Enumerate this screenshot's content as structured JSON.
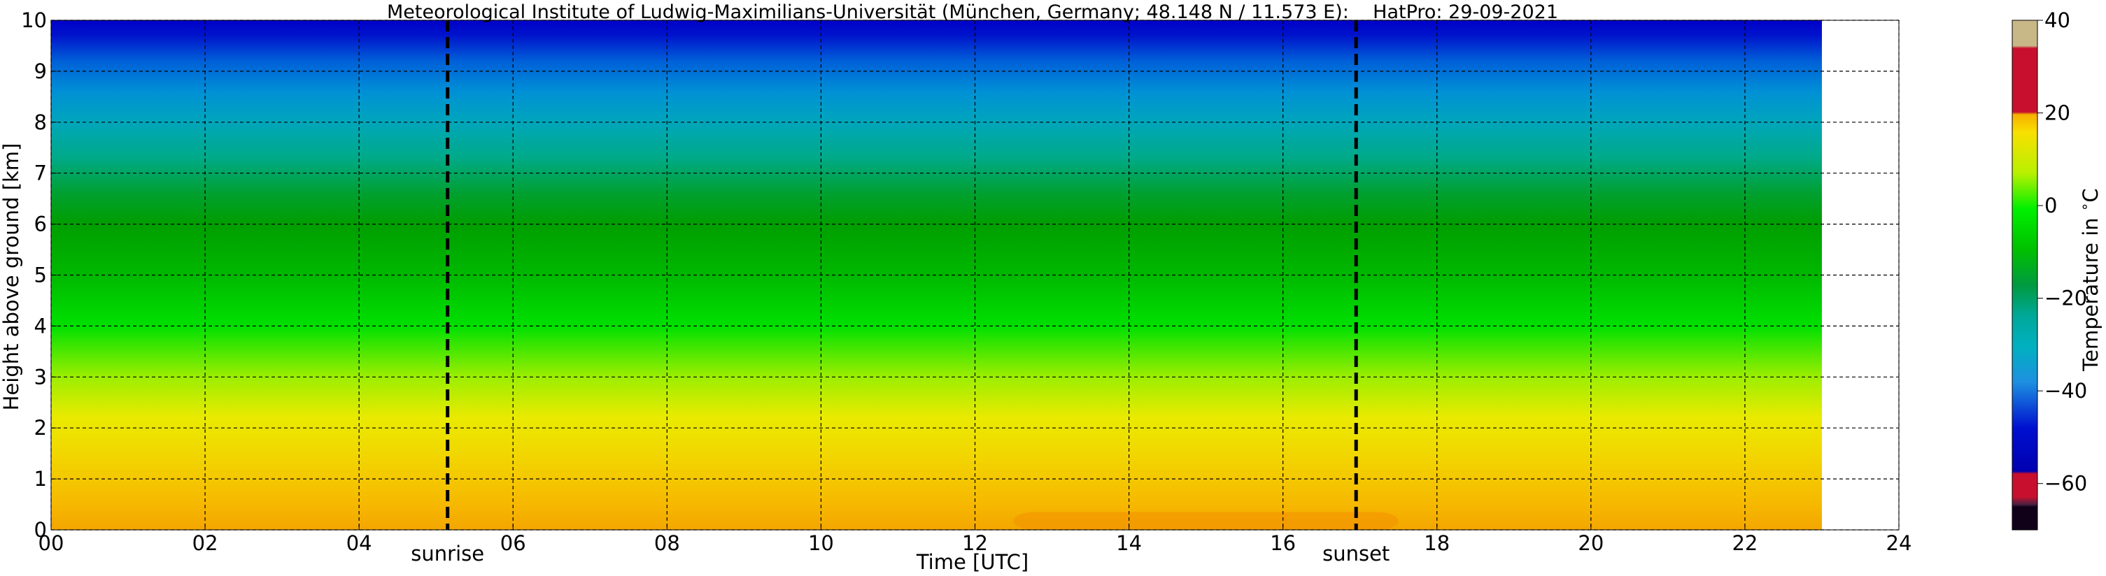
{
  "chart_data": {
    "type": "heatmap",
    "title": "Meteorological Institute of Ludwig-Maximilians-Universität (München, Germany; 48.148 N / 11.573 E):    HatPro: 29-09-2021",
    "xlabel": "Time [UTC]",
    "ylabel": "Height above ground [km]",
    "xlim": [
      0,
      24
    ],
    "ylim": [
      0,
      10
    ],
    "x_ticks": [
      "00",
      "02",
      "04",
      "06",
      "08",
      "10",
      "12",
      "14",
      "16",
      "18",
      "20",
      "22",
      "24"
    ],
    "y_ticks": [
      "0",
      "1",
      "2",
      "3",
      "4",
      "5",
      "6",
      "7",
      "8",
      "9",
      "10"
    ],
    "data_end_hour": 23.0,
    "grid": true,
    "markers": [
      {
        "label": "sunrise",
        "hour": 5.15
      },
      {
        "label": "sunset",
        "hour": 16.95
      }
    ],
    "colorbar": {
      "label": "Temperature in $^\\circ$C",
      "range": [
        -70,
        40
      ],
      "ticks": [
        "40",
        "20",
        "0",
        "−20",
        "−40",
        "−60"
      ]
    },
    "temperature_profile": {
      "heights_km": [
        0,
        1,
        2,
        3,
        4,
        5,
        6,
        7,
        8,
        9,
        10
      ],
      "approx_temp_c": [
        13,
        9,
        4,
        -2,
        -8,
        -15,
        -22,
        -29,
        -37,
        -45,
        -52
      ]
    }
  }
}
